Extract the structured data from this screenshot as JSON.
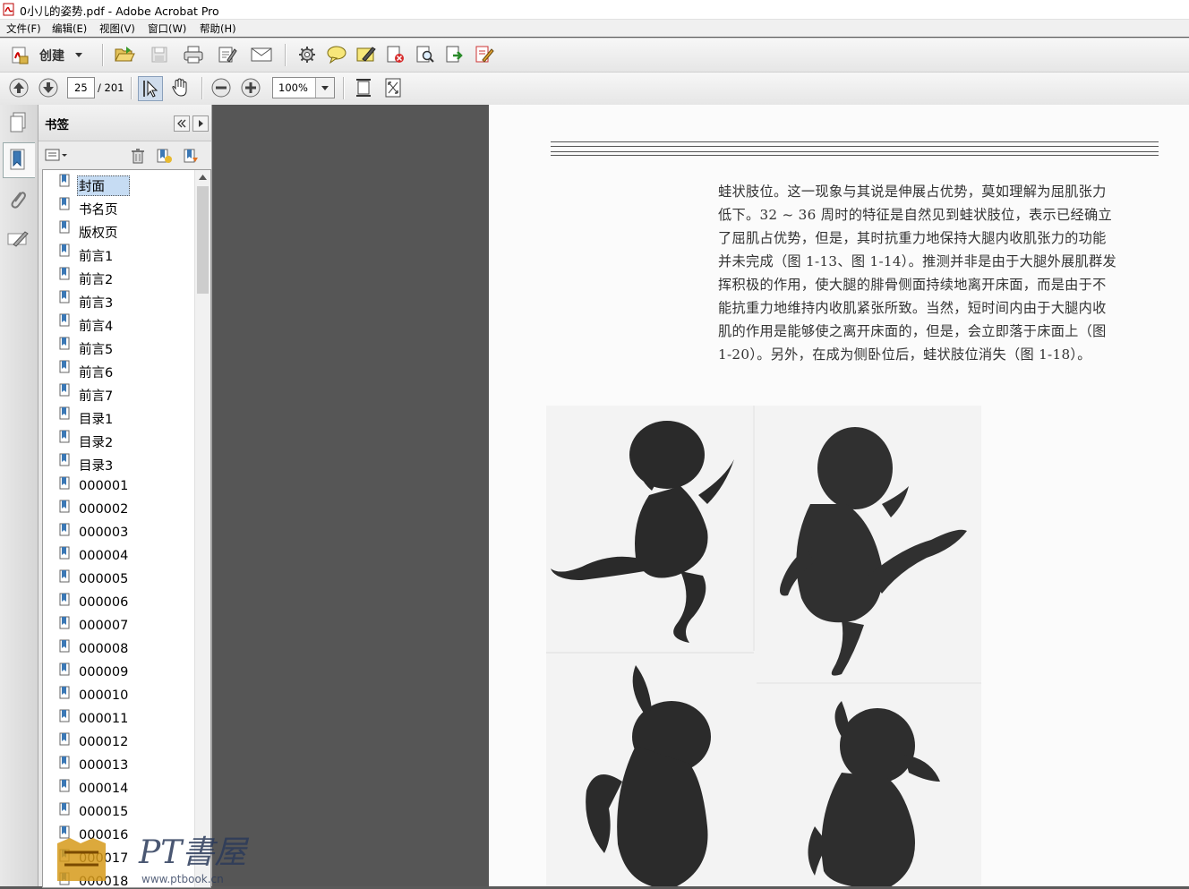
{
  "window": {
    "title": "0小儿的姿势.pdf - Adobe Acrobat Pro"
  },
  "menu": [
    "文件(F)",
    "编辑(E)",
    "视图(V)",
    "窗口(W)",
    "帮助(H)"
  ],
  "toolbar": {
    "create_label": "创建"
  },
  "nav": {
    "page_current": "25",
    "page_total": "/ 201",
    "zoom": "100%"
  },
  "bookmarks": {
    "title": "书签",
    "items": [
      "封面",
      "书名页",
      "版权页",
      "前言1",
      "前言2",
      "前言3",
      "前言4",
      "前言5",
      "前言6",
      "前言7",
      "目录1",
      "目录2",
      "目录3",
      "000001",
      "000002",
      "000003",
      "000004",
      "000005",
      "000006",
      "000007",
      "000008",
      "000009",
      "000010",
      "000011",
      "000012",
      "000013",
      "000014",
      "000015",
      "000016",
      "000017",
      "000018"
    ],
    "selected_index": 0
  },
  "document": {
    "lines": [
      "蛙状肢位。这一现象与其说是伸展占优势，莫如理解为屈肌张力",
      "低下。32 ~ 36 周时的特征是自然见到蛙状肢位，表示已经确立",
      "了屈肌占优势，但是，其时抗重力地保持大腿内收肌张力的功能",
      "并未完成（图 1-13、图 1-14）。推测并非是由于大腿外展肌群发",
      "挥积极的作用，使大腿的腓骨侧面持续地离开床面，而是由于不",
      "能抗重力地维持内收肌紧张所致。当然，短时间内由于大腿内收",
      "肌的作用是能够使之离开床面的，但是，会立即落于床面上（图",
      "1-20）。另外，在成为侧卧位后，蛙状肢位消失（图 1-18）。"
    ]
  },
  "watermark": {
    "text": "PT書屋",
    "url": "www.ptbook.cn"
  }
}
